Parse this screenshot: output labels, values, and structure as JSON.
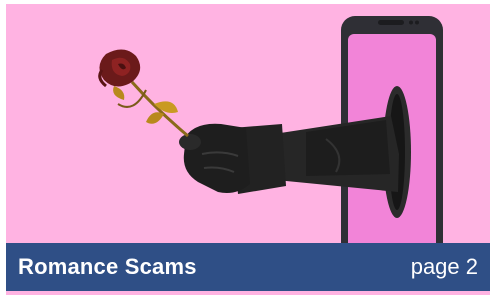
{
  "caption": {
    "title": "Romance Scams",
    "page": "page 2"
  },
  "colors": {
    "background": "#ffb3e2",
    "phone_body": "#2f2f35",
    "phone_screen": "#f284d8",
    "caption_bar": "#2f4f86",
    "caption_text": "#ffffff"
  },
  "icons": [
    "smartphone-illustration",
    "gloved-arm-illustration",
    "rose-illustration"
  ]
}
